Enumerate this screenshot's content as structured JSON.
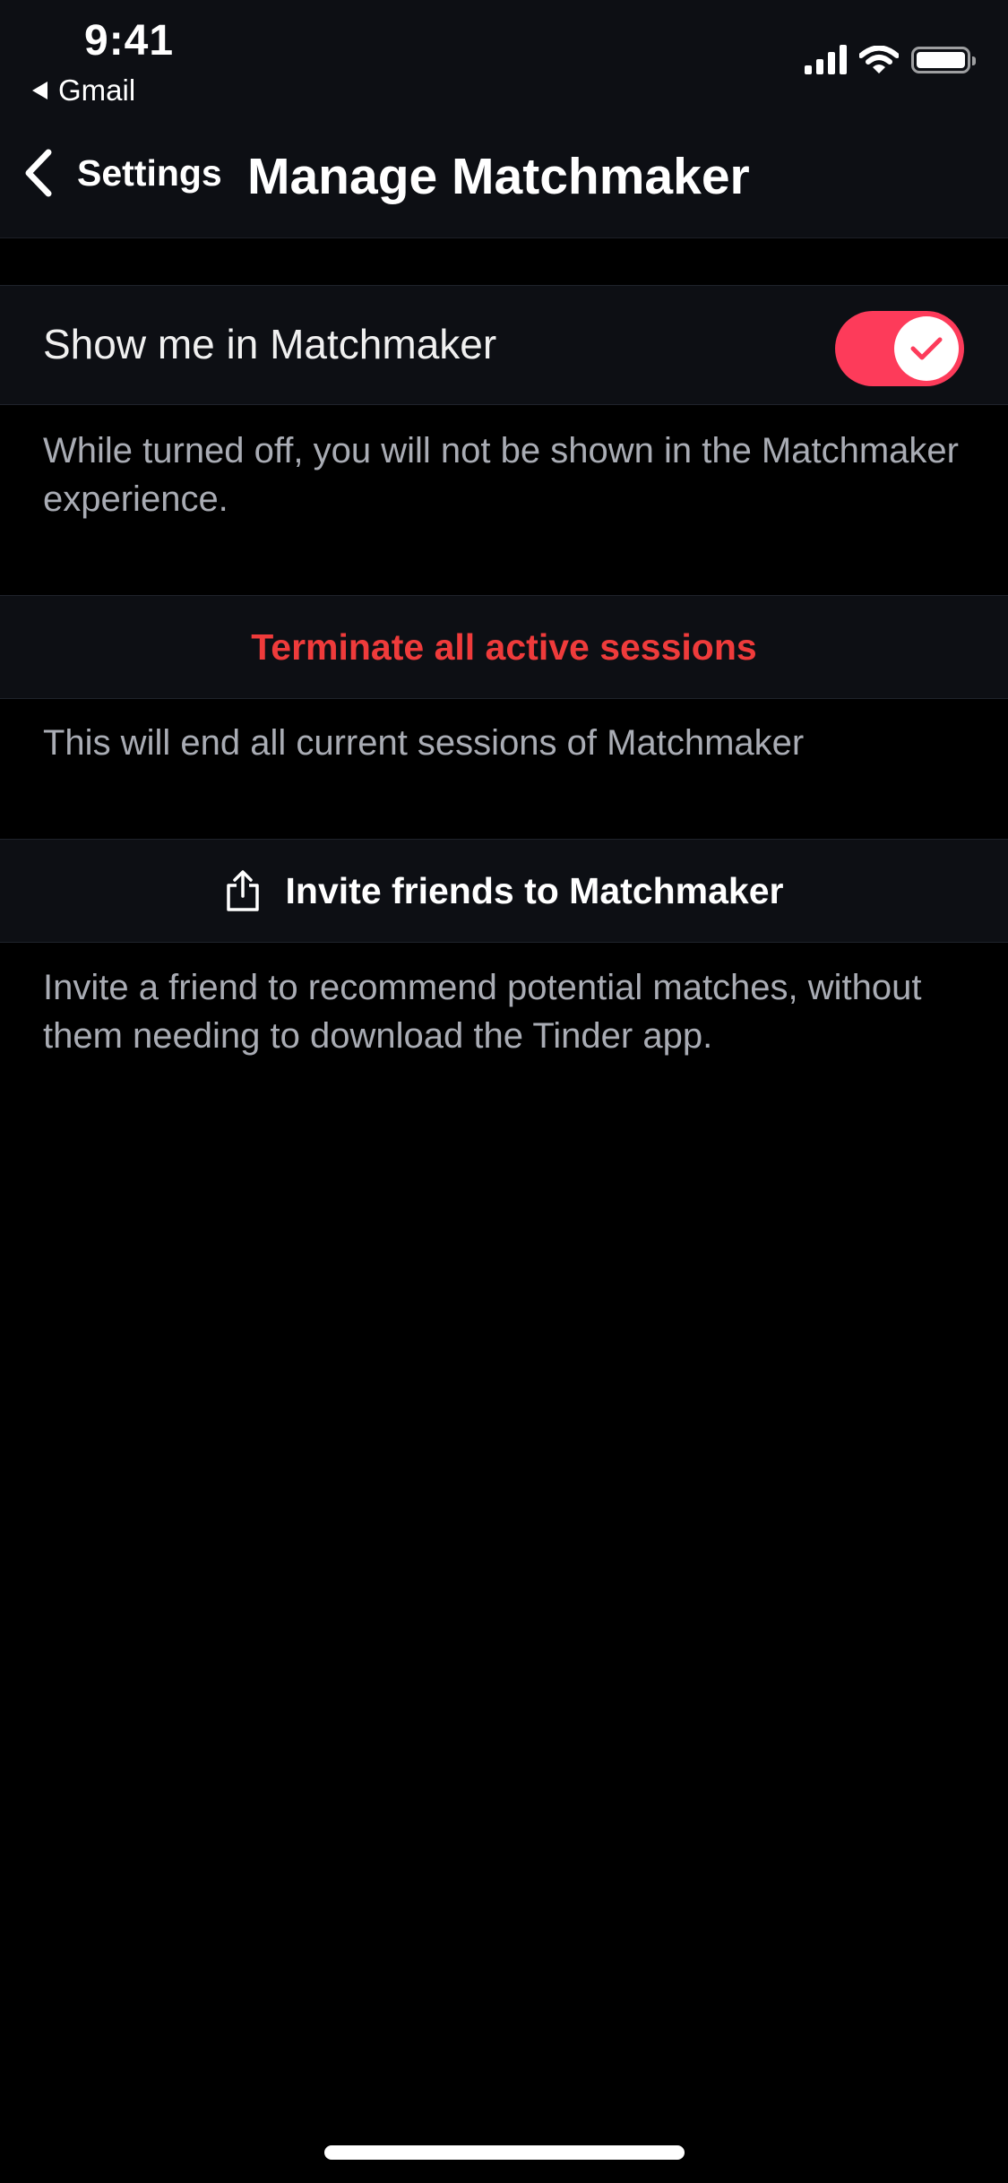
{
  "status_bar": {
    "time": "9:41",
    "back_app": "Gmail",
    "icons": [
      "cellular-signal-icon",
      "wifi-icon",
      "battery-icon"
    ]
  },
  "nav": {
    "back_label": "Settings",
    "title": "Manage Matchmaker"
  },
  "show_in_matchmaker": {
    "label": "Show me in Matchmaker",
    "enabled": true,
    "description": "While turned off, you will not be shown in the Matchmaker experience."
  },
  "terminate": {
    "label": "Terminate all active sessions",
    "description": "This will end all current sessions of Matchmaker"
  },
  "invite": {
    "label": "Invite friends to Matchmaker",
    "icon": "share-icon",
    "description": "Invite a friend to recommend potential matches, without them needing to download the Tinder app."
  },
  "colors": {
    "accent": "#fd3b5a",
    "destructive_text": "#ef3b3b",
    "row_background": "#0d0f14",
    "page_background": "#000000",
    "secondary_text": "#a9acb4"
  }
}
